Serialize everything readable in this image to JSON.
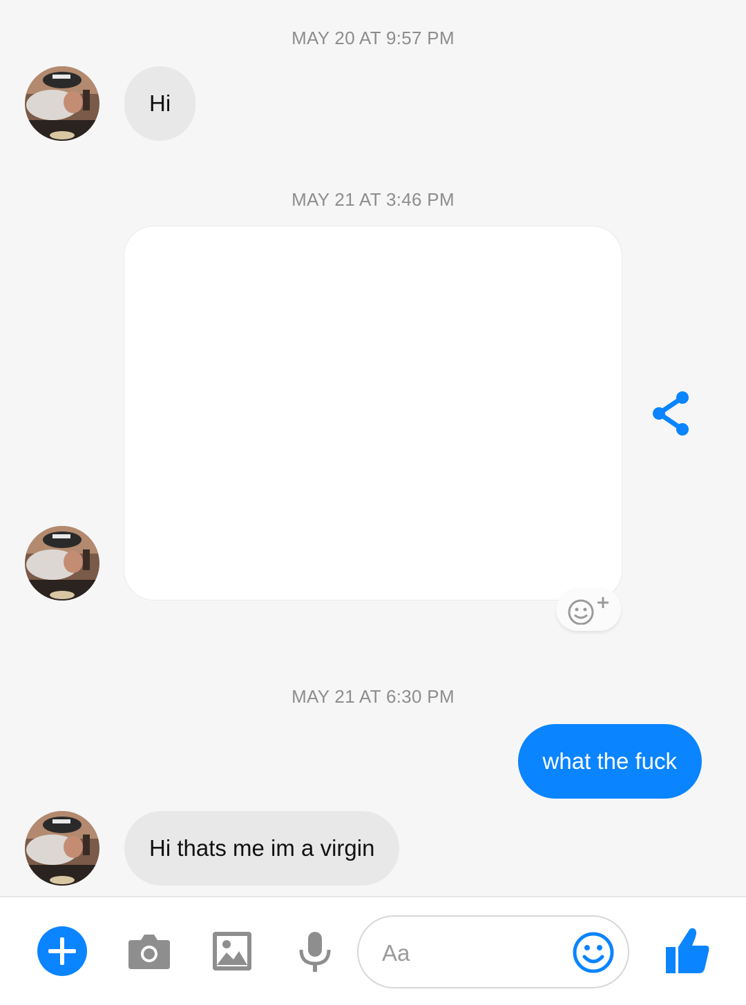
{
  "conversation": {
    "timestamps": [
      "MAY 20 AT 9:57 PM",
      "MAY 21 AT 3:46 PM",
      "MAY 21 AT 6:30 PM"
    ],
    "messages": {
      "m1": "Hi",
      "m2_type": "image attachment (blank)",
      "m3": "what the fuck",
      "m4": "Hi thats me im a virgin"
    }
  },
  "composer": {
    "placeholder": "Aa"
  },
  "colors": {
    "accent": "#0a84ff",
    "incoming_bubble": "#e8e8e9",
    "timestamp": "#8d8d8d",
    "background": "#f6f6f7"
  },
  "icons": [
    "plus-icon",
    "camera-icon",
    "image-icon",
    "microphone-icon",
    "emoji-icon",
    "thumbs-up-icon",
    "share-icon",
    "add-reaction-icon"
  ]
}
